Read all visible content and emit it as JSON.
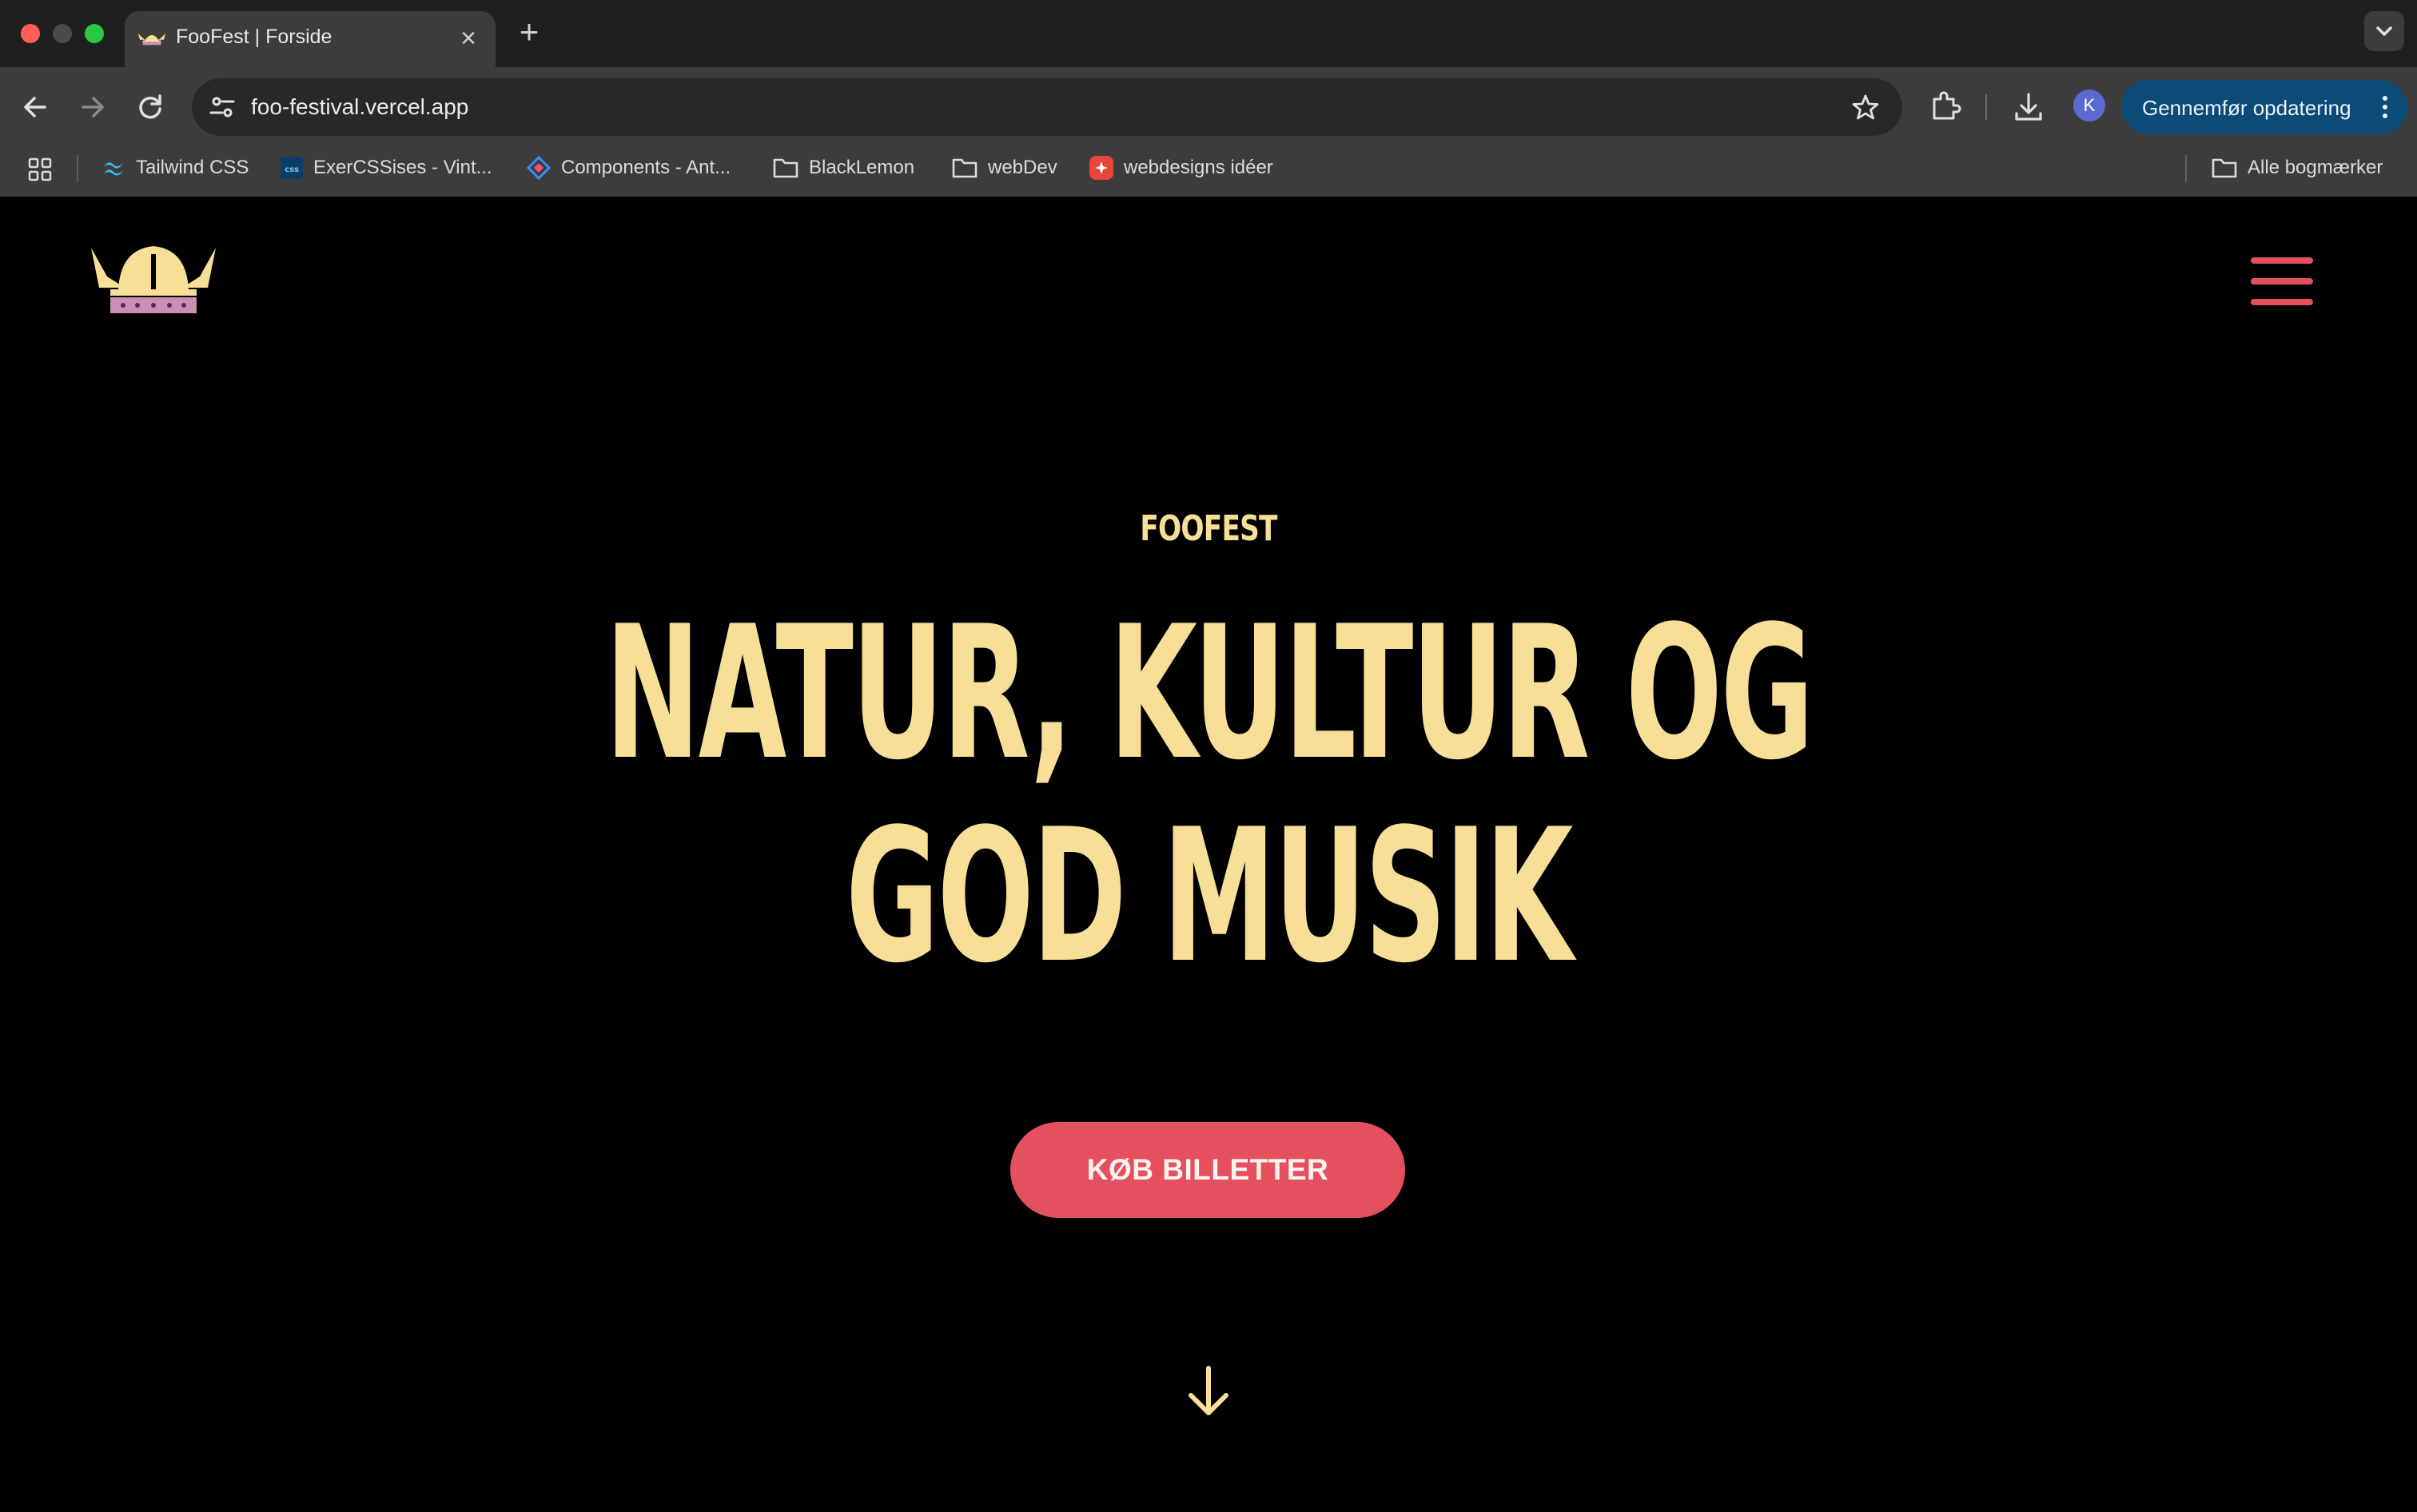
{
  "browser": {
    "tab": {
      "title": "FooFest | Forside",
      "close": "×"
    },
    "new_tab": "+",
    "address": "foo-festival.vercel.app",
    "avatar_initial": "K",
    "update_button": "Gennemfør opdatering",
    "bookmarks": [
      {
        "label": "Tailwind CSS",
        "icon": "tailwind-icon"
      },
      {
        "label": "ExerCSSises - Vint...",
        "icon": "css-icon"
      },
      {
        "label": "Components - Ant...",
        "icon": "components-icon"
      },
      {
        "label": "BlackLemon",
        "icon": "folder-icon"
      },
      {
        "label": "webDev",
        "icon": "folder-icon"
      },
      {
        "label": "webdesigns idéer",
        "icon": "webdesigns-icon"
      }
    ],
    "all_bookmarks": "Alle bogmærker"
  },
  "page": {
    "eyebrow": "FOOFEST",
    "headline_line1": "NATUR, KULTUR OG",
    "headline_line2": "GOD MUSIK",
    "cta": "KØB BILLETTER"
  },
  "colors": {
    "accent_yellow": "#f7df97",
    "accent_red": "#e5505f",
    "logo_pink": "#c98fb6",
    "background": "#000000"
  }
}
